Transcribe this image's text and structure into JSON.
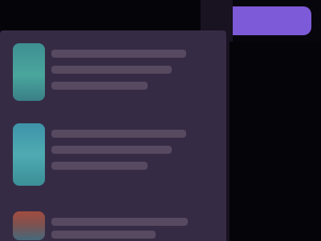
{
  "colors": {
    "background": "#07050c",
    "accent": "#7d5ad7",
    "panel": "#362b45",
    "thumbnail_teal": "#4aa69d",
    "thumbnail_blue": "#4eabb2",
    "thumbnail_red": "#a24d3f"
  },
  "header": {
    "cta_label": ""
  },
  "feed": {
    "items": [
      {
        "title": "",
        "subtitle": "",
        "meta": ""
      },
      {
        "title": "",
        "subtitle": "",
        "meta": ""
      },
      {
        "title": "",
        "subtitle": ""
      }
    ]
  }
}
